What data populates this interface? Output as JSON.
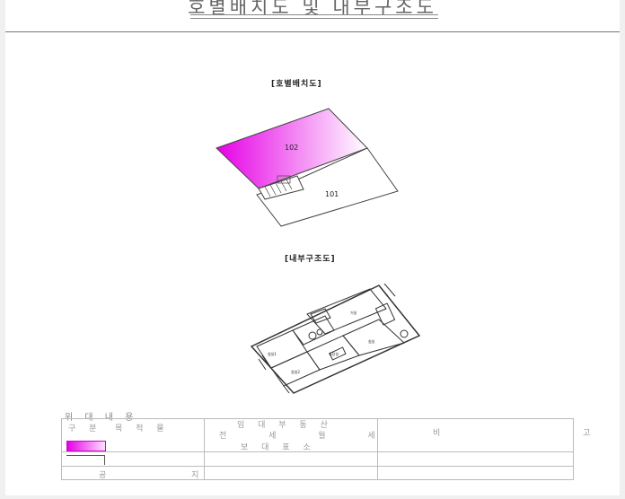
{
  "document": {
    "title": "호별배치도 및 내부구조도",
    "section_layout": "[호별배치도]",
    "section_interior": "[내부구조도]",
    "units": {
      "unit_102": "102",
      "unit_101": "101"
    },
    "room_labels": {
      "room_a": "거실",
      "room_b": "침실",
      "room_c": "침실1",
      "room_d": "침실2",
      "room_e": "화장실"
    }
  },
  "legend": {
    "heading": "위 대 내 용",
    "columns": {
      "col1": "구 분",
      "col2": "목 적 물",
      "col3_line1": "임 대 부 동 산",
      "col3_line2": "전 세 월 세",
      "col3_line3": "보 대 표 소",
      "col4": "비 고"
    },
    "rows": {
      "row3_label": "공 지"
    }
  },
  "colors": {
    "highlight_start": "#e600e6",
    "highlight_end": "#ffffff",
    "line": "#444444"
  }
}
